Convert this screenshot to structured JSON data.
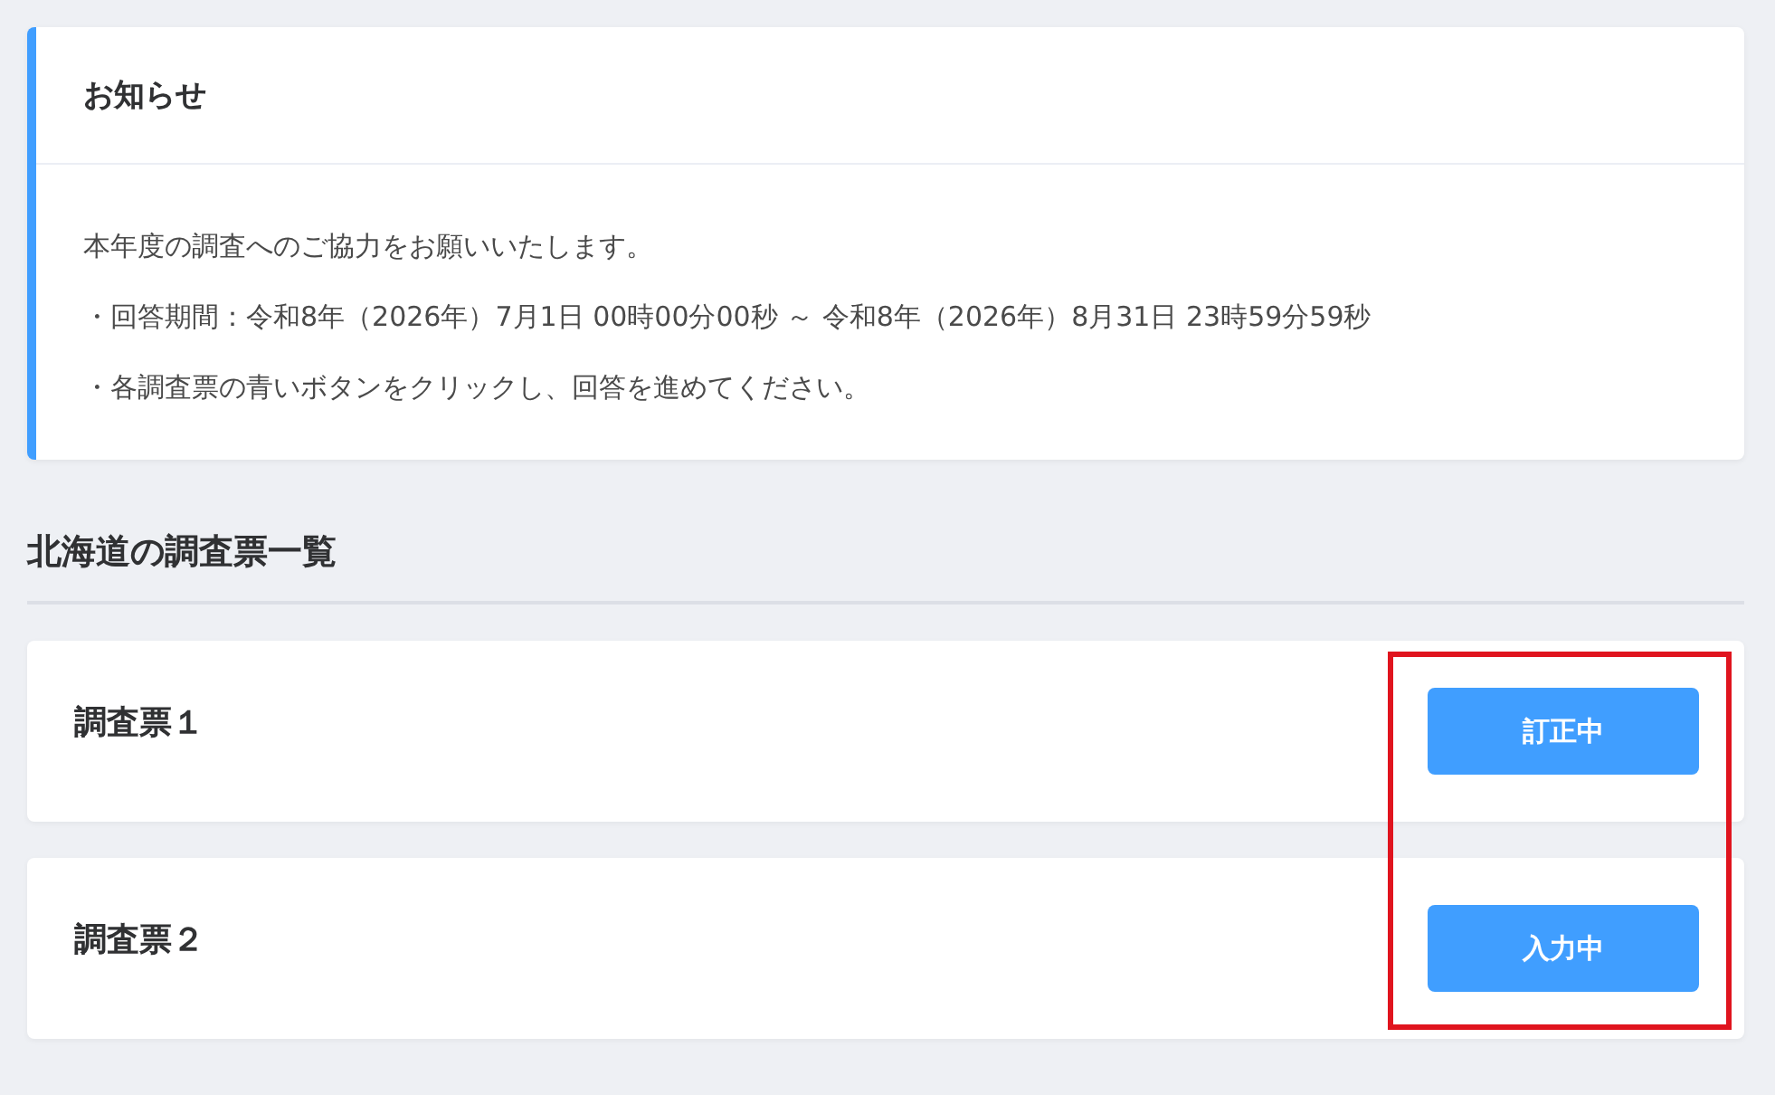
{
  "notice": {
    "title": "お知らせ",
    "lines": [
      "本年度の調査へのご協力をお願いいたします。",
      "・回答期間：令和8年（2026年）7月1日 00時00分00秒 ～ 令和8年（2026年）8月31日 23時59分59秒",
      "・各調査票の青いボタンをクリックし、回答を進めてください。"
    ]
  },
  "section": {
    "title": "北海道の調査票一覧"
  },
  "surveys": [
    {
      "name": "調査票１",
      "button": "訂正中"
    },
    {
      "name": "調査票２",
      "button": "入力中"
    }
  ]
}
